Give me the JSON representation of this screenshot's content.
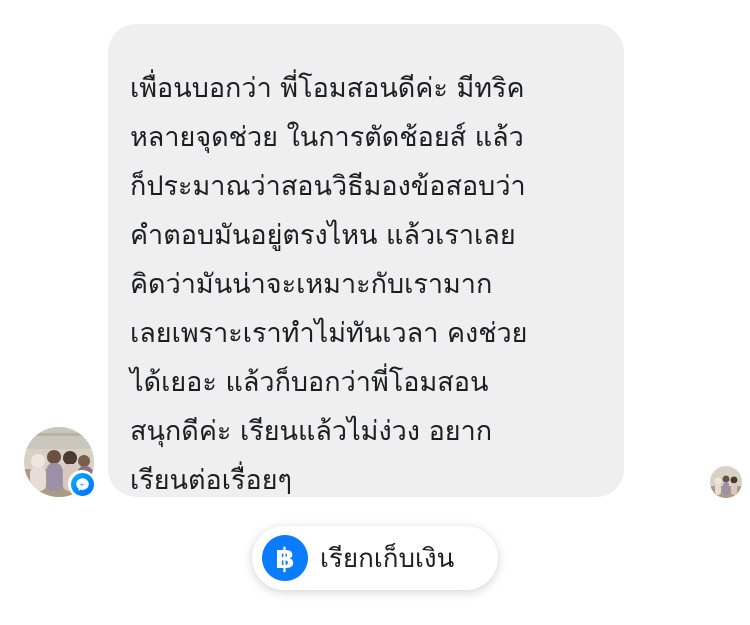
{
  "message": {
    "lines": [
      "เพื่อนบอกว่า พี่โอมสอนดีค่ะ มีทริค",
      "หลายจุดช่วย ในการตัดช้อยส์ แล้ว",
      "ก็ประมาณว่าสอนวิธีมองข้อสอบว่า",
      "คำตอบมันอยู่ตรงไหน แล้วเราเลย",
      "คิดว่ามันน่าจะเหมาะกับเรามาก",
      "เลยเพราะเราทำไม่ทันเวลา คงช่วย",
      "ได้เยอะ แล้วก็บอกว่าพี่โอมสอน",
      "สนุกดีค่ะ เรียนแล้วไม่ง่วง อยาก",
      "เรียนต่อเรื่อยๆ"
    ]
  },
  "sender": {
    "avatar_icon": "group-photo-avatar",
    "badge_icon": "messenger-icon"
  },
  "seen_indicator": {
    "avatar_icon": "group-photo-avatar"
  },
  "request_button": {
    "icon": "baht-icon",
    "symbol": "฿",
    "label": "เรียกเก็บเงิน"
  },
  "colors": {
    "bubble_bg": "#efefef",
    "text": "#1c1e21",
    "accent": "#0a7cff"
  }
}
